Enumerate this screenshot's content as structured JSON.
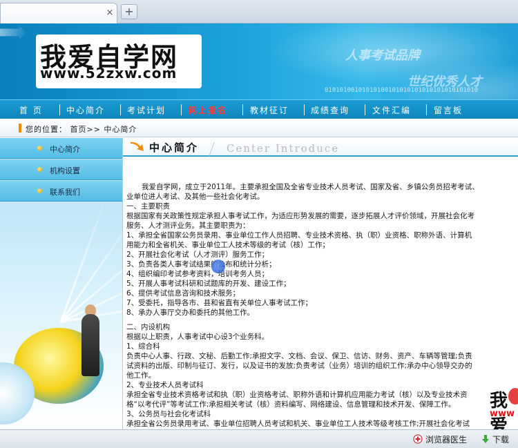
{
  "browser": {
    "tab_close": "×",
    "new_tab": "+"
  },
  "banner": {
    "logo_cn": "我爱自学网",
    "logo_url": "www.52zxw.com",
    "slogan_1": "人事考试品牌",
    "slogan_2": "世纪优秀人才",
    "binary": "01010100101010100101010101010101010101010"
  },
  "nav": {
    "items": [
      {
        "label": "首 页",
        "hot": false
      },
      {
        "label": "中心简介",
        "hot": false
      },
      {
        "label": "考试计划",
        "hot": false
      },
      {
        "label": "网上报名",
        "hot": true
      },
      {
        "label": "教材征订",
        "hot": false
      },
      {
        "label": "成绩查询",
        "hot": false
      },
      {
        "label": "文件汇编",
        "hot": false
      },
      {
        "label": "留言板",
        "hot": false
      }
    ]
  },
  "breadcrumb": {
    "text": "您的位置： 首页>> 中心简介"
  },
  "sidebar": {
    "items": [
      {
        "label": "中心简介"
      },
      {
        "label": "机构设置"
      },
      {
        "label": "联系我们"
      }
    ]
  },
  "content": {
    "heading_cn": "中心简介",
    "heading_en": "Center Introduce",
    "lines": [
      {
        "text": "我爱自学网，成立于2011年。主要承担全国及全省专业技术人员考试、国家及省、乡镇公务员招考考试、",
        "indent": true
      },
      {
        "text": "业单位进人考试、及其他一些社会化考试。",
        "indent": false
      },
      {
        "text": "一、主要职责",
        "indent": false
      },
      {
        "text": "根据国家有关政策性规定承担人事考试工作，为适应形势发展的需要，逐步拓展人才评价领域，开展社会化考",
        "indent": false
      },
      {
        "text": "服务、人才测评业务。其主要职责为：",
        "indent": false
      },
      {
        "text": "1、承担全省国家公务员录用、事业单位工作人员招聘、专业技术资格、执（职）业资格、职称外语、计算机",
        "indent": false
      },
      {
        "text": "用能力和全省机关、事业单位工人技术等级的考试（核）工作；",
        "indent": false
      },
      {
        "text": "2、开展社会化考试（人才测评）服务工作；",
        "indent": false
      },
      {
        "text": "3、负责各类人事考试结果的公布和统计分析；",
        "indent": false
      },
      {
        "text": "4、组织编印考试参考资料，培训考务人员；",
        "indent": false
      },
      {
        "text": "5、开展人事考试科研和试题库的开发、建设工作；",
        "indent": false
      },
      {
        "text": "6、提供考试信息咨询和技术服务；",
        "indent": false
      },
      {
        "text": "7、受委托，指导各市、县和省直有关单位人事考试工作；",
        "indent": false
      },
      {
        "text": "8、承办人事厅交办和委托的其他工作。",
        "indent": false
      },
      {
        "text": "",
        "indent": false,
        "gap": true
      },
      {
        "text": "二、内设机构",
        "indent": false
      },
      {
        "text": "根据以上职责，人事考试中心设3个业务科。",
        "indent": false
      },
      {
        "text": "1、综合科",
        "indent": false
      },
      {
        "text": "负责中心人事、行政、文秘、后勤工作;承担文字、文档、会议、保卫、信访、财务、资产、车辆等管理;负责",
        "indent": false
      },
      {
        "text": "试资料的出版、印制与征订、发行，以及证书的发放;负责考试（业务）培训的组织工作;承办中心领导交办的",
        "indent": false
      },
      {
        "text": "他工作。",
        "indent": false
      },
      {
        "text": "2、专业技术人员考试科",
        "indent": false
      },
      {
        "text": "承担全省专业技术资格考试和执（职）业资格考试、职称外语和计算机应用能力考试（核）以及专业技术资",
        "indent": false
      },
      {
        "text": "格“以考代评”等考试工作;承担相关考试（核）资料编写、网络建设、信息管理和技术开发、保障工作。",
        "indent": false
      },
      {
        "text": "3、公务员与社会化考试科",
        "indent": false
      },
      {
        "text": "承担全省公务员录用考试、事业单位招聘人员考试和机关、事业单位工人技术等级考核工作;开展社会化考试",
        "indent": false
      }
    ],
    "watermark_cn": "我爱",
    "watermark_url": "www"
  },
  "statusbar": {
    "doctor": "浏览器医生",
    "download": "下载"
  }
}
